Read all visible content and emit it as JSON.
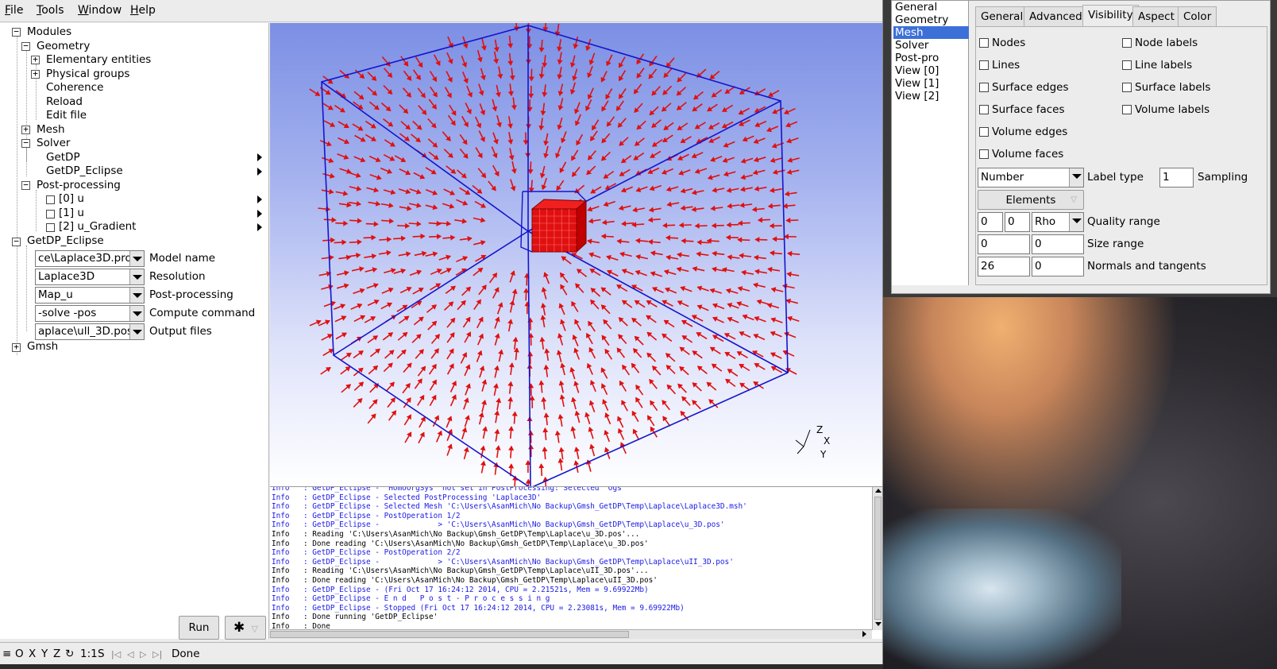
{
  "menubar": {
    "items": [
      "File",
      "Tools",
      "Window",
      "Help"
    ],
    "underline": [
      "F",
      "T",
      "W",
      "H"
    ]
  },
  "tree": {
    "modules": "Modules",
    "geometry": "Geometry",
    "elementary_entities": "Elementary entities",
    "physical_groups": "Physical groups",
    "coherence": "Coherence",
    "reload": "Reload",
    "edit_file": "Edit file",
    "mesh": "Mesh",
    "solver": "Solver",
    "getdp": "GetDP",
    "getdp_eclipse_solver": "GetDP_Eclipse",
    "post_processing": "Post-processing",
    "views": [
      "[0] u",
      "[1] u",
      "[2] u_Gradient"
    ],
    "getdp_eclipse": "GetDP_Eclipse",
    "gmsh": "Gmsh",
    "params": [
      {
        "value": "ce\\Laplace3D.pro",
        "label": "Model name"
      },
      {
        "value": "Laplace3D",
        "label": "Resolution"
      },
      {
        "value": "Map_u",
        "label": "Post-processing"
      },
      {
        "value": "-solve -pos",
        "label": "Compute command"
      },
      {
        "value": "aplace\\ull_3D.pos",
        "label": "Output files"
      }
    ],
    "expand_symbols": {
      "expanded": "−",
      "collapsed": "+"
    }
  },
  "buttons": {
    "run": "Run",
    "gear_symbol": "✱",
    "gear_dropdown": "▽"
  },
  "graphic": {
    "axes": {
      "x": "X",
      "y": "Y",
      "z": "Z"
    },
    "background_top": "#7c8fe4",
    "box_color": "#1414cc",
    "arrow_color": "#e01010"
  },
  "console": {
    "lines": [
      {
        "level": "Info",
        "text": ": GetDP_Eclipse - 'HomoOrgSys' not set in PostProcessing: Selected 'Ogs'",
        "blue": true
      },
      {
        "level": "Info",
        "text": ": GetDP_Eclipse - Selected PostProcessing 'Laplace3D'",
        "blue": true
      },
      {
        "level": "Info",
        "text": ": GetDP_Eclipse - Selected Mesh 'C:\\Users\\AsanMich\\No Backup\\Gmsh_GetDP\\Temp\\Laplace\\Laplace3D.msh'",
        "blue": true
      },
      {
        "level": "Info",
        "text": ": GetDP_Eclipse - PostOperation 1/2",
        "blue": true
      },
      {
        "level": "Info",
        "text": ": GetDP_Eclipse -             > 'C:\\Users\\AsanMich\\No Backup\\Gmsh_GetDP\\Temp\\Laplace\\u_3D.pos'",
        "blue": true
      },
      {
        "level": "Info",
        "text": ": Reading 'C:\\Users\\AsanMich\\No Backup\\Gmsh_GetDP\\Temp\\Laplace\\u_3D.pos'...",
        "blue": false
      },
      {
        "level": "Info",
        "text": ": Done reading 'C:\\Users\\AsanMich\\No Backup\\Gmsh_GetDP\\Temp\\Laplace\\u_3D.pos'",
        "blue": false
      },
      {
        "level": "Info",
        "text": ": GetDP_Eclipse - PostOperation 2/2",
        "blue": true
      },
      {
        "level": "Info",
        "text": ": GetDP_Eclipse -             > 'C:\\Users\\AsanMich\\No Backup\\Gmsh_GetDP\\Temp\\Laplace\\uII_3D.pos'",
        "blue": true
      },
      {
        "level": "Info",
        "text": ": Reading 'C:\\Users\\AsanMich\\No Backup\\Gmsh_GetDP\\Temp\\Laplace\\uII_3D.pos'...",
        "blue": false
      },
      {
        "level": "Info",
        "text": ": Done reading 'C:\\Users\\AsanMich\\No Backup\\Gmsh_GetDP\\Temp\\Laplace\\uII_3D.pos'",
        "blue": false
      },
      {
        "level": "Info",
        "text": ": GetDP_Eclipse - (Fri Oct 17 16:24:12 2014, CPU = 2.21521s, Mem = 9.69922Mb)",
        "blue": true
      },
      {
        "level": "Info",
        "text": ": GetDP_Eclipse - E n d   P o s t - P r o c e s s i n g",
        "blue": true
      },
      {
        "level": "Info",
        "text": ": GetDP_Eclipse - Stopped (Fri Oct 17 16:24:12 2014, CPU = 2.23081s, Mem = 9.69922Mb)",
        "blue": true
      },
      {
        "level": "Info",
        "text": ": Done running 'GetDP_Eclipse'",
        "blue": false
      },
      {
        "level": "Info",
        "text": ": Done",
        "blue": false
      }
    ]
  },
  "statusbar": {
    "menu_icon": "≡",
    "o": "O",
    "x": "X",
    "y": "Y",
    "z": "Z",
    "rotate_icon": "↻",
    "scale": "1:1",
    "s": "S",
    "first": "|◁",
    "prev": "◁",
    "next": "▷",
    "last": "▷|",
    "status": "Done"
  },
  "options": {
    "categories": [
      "General",
      "Geometry",
      "Mesh",
      "Solver",
      "Post-pro",
      "View [0]",
      "View [1]",
      "View [2]"
    ],
    "selected_category": "Mesh",
    "tabs": [
      "General",
      "Advanced",
      "Visibility",
      "Aspect",
      "Color"
    ],
    "active_tab": "Visibility",
    "checks_left": [
      "Nodes",
      "Lines",
      "Surface edges",
      "Surface faces",
      "Volume edges",
      "Volume faces"
    ],
    "checks_right": [
      "Node labels",
      "Line labels",
      "Surface labels",
      "Volume labels"
    ],
    "label_type_value": "Number",
    "label_type_label": "Label type",
    "sampling_value": "1",
    "sampling_label": "Sampling",
    "elements_button": "Elements",
    "elements_dropdown": "▽",
    "quality_min": "0",
    "quality_max": "0",
    "quality_type": "Rho",
    "quality_label": "Quality range",
    "size_min": "0",
    "size_max": "0",
    "size_label": "Size range",
    "normals_value": "26",
    "tangents_value": "0",
    "normals_label": "Normals and tangents"
  }
}
